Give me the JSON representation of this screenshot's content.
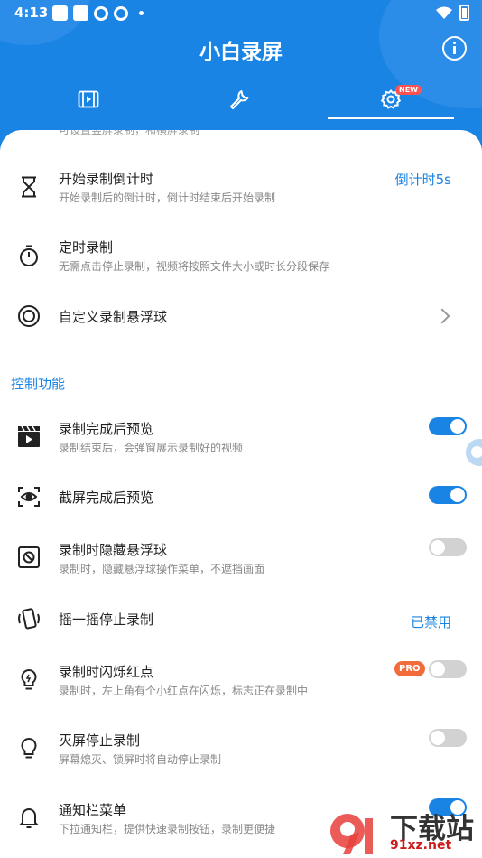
{
  "status_bar": {
    "time": "4:13"
  },
  "app": {
    "title": "小白录屏",
    "badge": "NEW"
  },
  "cut_text": "可设置竖屏录制，和横屏录制",
  "settings": [
    {
      "label": "开始录制倒计时",
      "desc": "开始录制后的倒计时，倒计时结束后开始录制",
      "value": "倒计时5s"
    },
    {
      "label": "定时录制",
      "desc": "无需点击停止录制，视频将按照文件大小或时长分段保存"
    },
    {
      "label": "自定义录制悬浮球"
    }
  ],
  "section_title": "控制功能",
  "controls": [
    {
      "label": "录制完成后预览",
      "desc": "录制结束后，会弹窗展示录制好的视频",
      "toggle": true
    },
    {
      "label": "截屏完成后预览",
      "toggle": true
    },
    {
      "label": "录制时隐藏悬浮球",
      "desc": "录制时，隐藏悬浮球操作菜单，不遮挡画面",
      "toggle": false
    },
    {
      "label": "摇一摇停止录制",
      "value": "已禁用"
    },
    {
      "label": "录制时闪烁红点",
      "desc": "录制时，左上角有个小红点在闪烁，标志正在录制中",
      "badge": "PRO",
      "toggle": false
    },
    {
      "label": "灭屏停止录制",
      "desc": "屏幕熄灭、锁屏时将自动停止录制",
      "toggle": false
    },
    {
      "label": "通知栏菜单",
      "desc": "下拉通知栏，提供快速录制按钮，录制更便捷",
      "toggle": true
    }
  ],
  "watermark": {
    "text": "下载站",
    "url": "91xz.net"
  }
}
